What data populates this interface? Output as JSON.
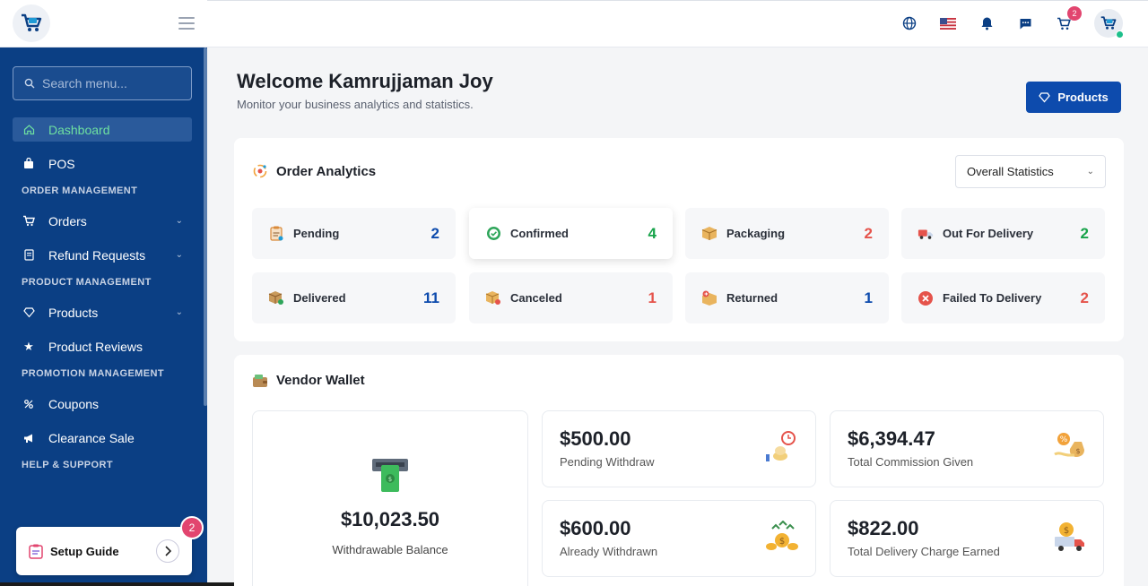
{
  "sidebar": {
    "search_placeholder": "Search menu...",
    "items": {
      "dashboard": "Dashboard",
      "pos": "POS",
      "orders": "Orders",
      "refund_requests": "Refund Requests",
      "products": "Products",
      "product_reviews": "Product Reviews",
      "coupons": "Coupons",
      "clearance_sale": "Clearance Sale"
    },
    "sections": {
      "order_management": "ORDER MANAGEMENT",
      "product_management": "PRODUCT MANAGEMENT",
      "promotion_management": "PROMOTION MANAGEMENT",
      "help_support": "HELP & SUPPORT"
    },
    "setup_guide": {
      "label": "Setup Guide",
      "badge": "2"
    },
    "active_color": "#6ee0a0",
    "background": "#0b3f84"
  },
  "topbar": {
    "icons": [
      "globe-icon",
      "us-flag-icon",
      "bell-icon",
      "message-icon",
      "cart-icon",
      "avatar"
    ],
    "cart_badge": "2"
  },
  "header": {
    "title": "Welcome Kamrujjaman Joy",
    "subtitle": "Monitor your business analytics and statistics.",
    "products_button": "Products"
  },
  "order_analytics": {
    "title": "Order Analytics",
    "filter": "Overall Statistics",
    "statuses": [
      {
        "label": "Pending",
        "count": "2",
        "color": "#0d4bad"
      },
      {
        "label": "Confirmed",
        "count": "4",
        "color": "#17a34a"
      },
      {
        "label": "Packaging",
        "count": "2",
        "color": "#e5534b"
      },
      {
        "label": "Out For Delivery",
        "count": "2",
        "color": "#17a34a"
      },
      {
        "label": "Delivered",
        "count": "11",
        "color": "#0d4bad"
      },
      {
        "label": "Canceled",
        "count": "1",
        "color": "#e5534b"
      },
      {
        "label": "Returned",
        "count": "1",
        "color": "#0d4bad"
      },
      {
        "label": "Failed To Delivery",
        "count": "2",
        "color": "#e5534b"
      }
    ]
  },
  "vendor_wallet": {
    "title": "Vendor Wallet",
    "withdrawable": {
      "amount": "$10,023.50",
      "label": "Withdrawable Balance"
    },
    "tiles": [
      {
        "amount": "$500.00",
        "label": "Pending Withdraw"
      },
      {
        "amount": "$6,394.47",
        "label": "Total Commission Given"
      },
      {
        "amount": "$600.00",
        "label": "Already Withdrawn"
      },
      {
        "amount": "$822.00",
        "label": "Total Delivery Charge Earned"
      }
    ]
  },
  "brand_color": "#0d4bad"
}
